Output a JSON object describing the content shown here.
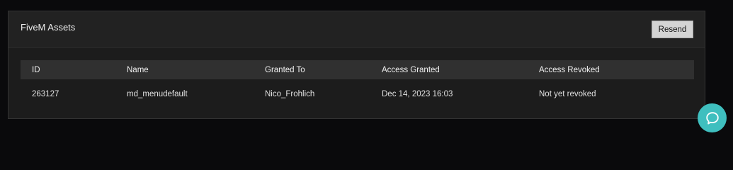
{
  "panel": {
    "title": "FiveM Assets",
    "resend_label": "Resend"
  },
  "table": {
    "headers": [
      "ID",
      "Name",
      "Granted To",
      "Access Granted",
      "Access Revoked"
    ],
    "rows": [
      [
        "263127",
        "md_menudefault",
        "Nico_Frohlich",
        "Dec 14, 2023 16:03",
        "Not yet revoked"
      ]
    ]
  },
  "colors": {
    "page_bg": "#0a0a0c",
    "panel_bg": "#1c1c1c",
    "header_row_bg": "#303030",
    "chat_button": "#3fbfbf"
  },
  "icons": {
    "chat": "chat-bubble-icon"
  }
}
